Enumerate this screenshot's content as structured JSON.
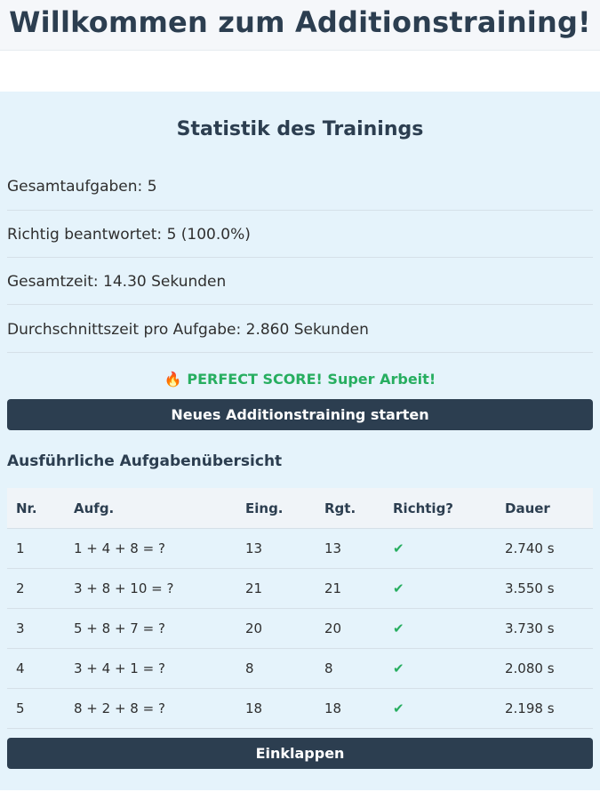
{
  "header": {
    "title": "Willkommen zum Additionstraining!"
  },
  "stats": {
    "heading": "Statistik des Trainings",
    "items": [
      {
        "label": "Gesamtaufgaben:",
        "value": "5"
      },
      {
        "label": "Richtig beantwortet:",
        "value": "5 (100.0%)"
      },
      {
        "label": "Gesamtzeit:",
        "value": "14.30 Sekunden"
      },
      {
        "label": "Durchschnittszeit pro Aufgabe:",
        "value": "2.860 Sekunden"
      }
    ],
    "perfect_emoji": "🔥",
    "perfect_text": "PERFECT SCORE! Super Arbeit!",
    "restart_label": "Neues Additionstraining starten"
  },
  "overview": {
    "title": "Ausführliche Aufgabenübersicht",
    "columns": [
      "Nr.",
      "Aufg.",
      "Eing.",
      "Rgt.",
      "Richtig?",
      "Dauer"
    ],
    "rows": [
      [
        "1",
        "1 + 4 + 8 = ?",
        "13",
        "13",
        "✔",
        "2.740 s"
      ],
      [
        "2",
        "3 + 8 + 10 = ?",
        "21",
        "21",
        "✔",
        "3.550 s"
      ],
      [
        "3",
        "5 + 8 + 7 = ?",
        "20",
        "20",
        "✔",
        "3.730 s"
      ],
      [
        "4",
        "3 + 4 + 1 = ?",
        "8",
        "8",
        "✔",
        "2.080 s"
      ],
      [
        "5",
        "8 + 2 + 8 = ?",
        "18",
        "18",
        "✔",
        "2.198 s"
      ]
    ],
    "collapse_label": "Einklappen"
  },
  "colors": {
    "primary": "#2c3e50",
    "success": "#27ae60",
    "panel_bg": "#e5f3fb"
  }
}
